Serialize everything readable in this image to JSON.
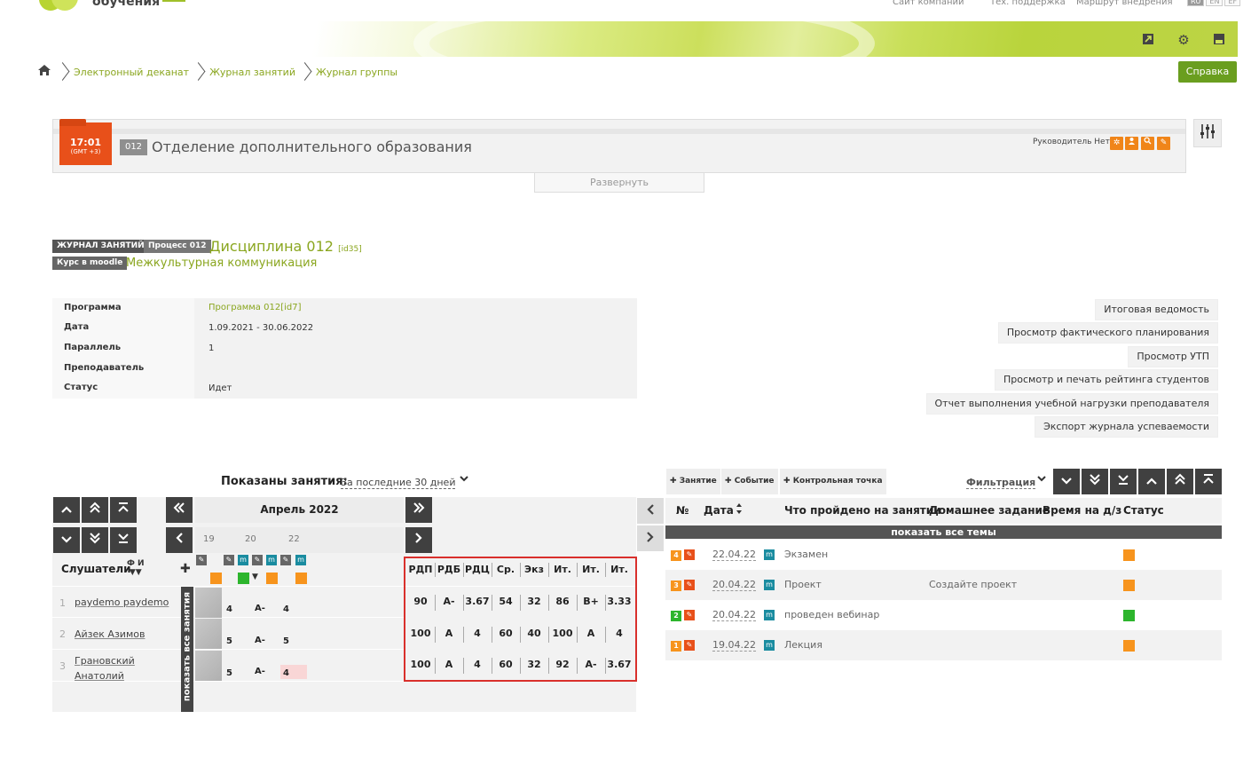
{
  "header": {
    "logo_text": "обучения",
    "top_links": [
      "Сайт компании",
      "Тех. поддержка",
      "Маршрут внедрения"
    ],
    "languages": [
      "RU",
      "EN",
      "EF"
    ]
  },
  "breadcrumb": [
    "Электронный деканат",
    "Журнал занятий",
    "Журнал группы"
  ],
  "help_label": "Справка",
  "department": {
    "time": "17:01",
    "timezone": "(GMT +3)",
    "code": "012",
    "name": "Отделение дополнительного образования",
    "head_label": "Руководитель Нет",
    "expand_label": "Развернуть"
  },
  "discipline": {
    "tag_journal": "ЖУРНАЛ ЗАНЯТИЙ",
    "tag_process": "Процесс 012",
    "tag_moodle": "Курс в moodle",
    "title": "Дисциплина 012",
    "title_id": "[id35]",
    "course": "Межкультурная коммуникация"
  },
  "info": {
    "rows": [
      {
        "label": "Программа",
        "value": "Программа 012[id7]"
      },
      {
        "label": "Дата",
        "value": "1.09.2021 - 30.06.2022"
      },
      {
        "label": "Параллель",
        "value": "1"
      },
      {
        "label": "Преподаватель",
        "value": ""
      },
      {
        "label": "Статус",
        "value": "Идет"
      }
    ]
  },
  "right_buttons": [
    "Итоговая ведомость",
    "Просмотр фактического планирования",
    "Просмотр УТП",
    "Просмотр и печать рейтинга студентов",
    "Отчет выполнения учебной нагрузки преподавателя",
    "Экспорт журнала успеваемости"
  ],
  "lessons_left": {
    "shown_label": "Показаны занятия:",
    "shown_value": "За последние 30 дней",
    "month": "Апрель 2022",
    "days": [
      "19",
      "20",
      "22"
    ],
    "listeners_label": "Слушатели",
    "sort_label": "Ф И",
    "show_all_vertical": "показать все занятия",
    "students": [
      {
        "num": "1",
        "name": "paydemo paydemo",
        "grades": [
          "4",
          "A-",
          "4"
        ]
      },
      {
        "num": "2",
        "name": "Айзек Азимов",
        "grades": [
          "5",
          "A-",
          "5"
        ]
      },
      {
        "num": "3",
        "name": "Грановский Анатолий",
        "grades": [
          "5",
          "A-",
          "4"
        ]
      }
    ],
    "summary_headers": [
      "РДП",
      "РДБ",
      "РДЦ",
      "Ср.",
      "Экз",
      "Ит.",
      "Ит.",
      "Ит."
    ],
    "summary_rows": [
      [
        "90",
        "A-",
        "3.67",
        "54",
        "32",
        "86",
        "B+",
        "3.33"
      ],
      [
        "100",
        "A",
        "4",
        "60",
        "40",
        "100",
        "A",
        "4"
      ],
      [
        "100",
        "A",
        "4",
        "60",
        "32",
        "92",
        "A-",
        "3.67"
      ]
    ]
  },
  "lessons_right": {
    "buttons": [
      "Занятие",
      "Событие",
      "Контрольная точка"
    ],
    "filter_label": "Фильтрация",
    "headers": [
      "№",
      "Дата",
      "Что пройдено на занятии",
      "Домашнее задание",
      "Время на д/з",
      "Статус"
    ],
    "show_all": "показать все темы",
    "rows": [
      {
        "num": "4",
        "date": "22.04.22",
        "topic": "Экзамен",
        "homework": "",
        "status_color": "#f7941d",
        "num_color": "#f7941d"
      },
      {
        "num": "3",
        "date": "20.04.22",
        "topic": "Проект",
        "homework": "Создайте проект",
        "status_color": "#f7941d",
        "num_color": "#f7941d"
      },
      {
        "num": "2",
        "date": "20.04.22",
        "topic": "проведен вебинар",
        "homework": "",
        "status_color": "#2db52d",
        "num_color": "#2db52d"
      },
      {
        "num": "1",
        "date": "19.04.22",
        "topic": "Лекция",
        "homework": "",
        "status_color": "#f7941d",
        "num_color": "#f7941d"
      }
    ]
  },
  "colors": {
    "accent": "#8aa61f",
    "orange": "#f7941d",
    "green": "#2db52d",
    "danger": "#d9302c"
  }
}
